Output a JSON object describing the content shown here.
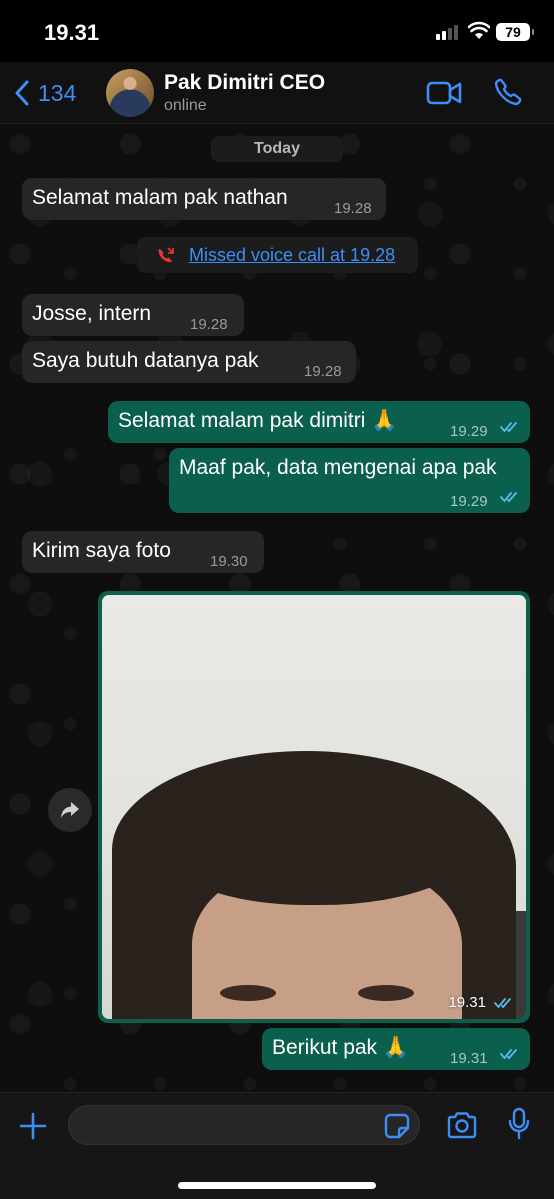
{
  "status_bar": {
    "time": "19.31",
    "battery": "79"
  },
  "header": {
    "back_count": "134",
    "contact_name": "Pak Dimitri CEO",
    "contact_status": "online"
  },
  "chat": {
    "date_label": "Today",
    "messages": [
      {
        "direction": "in",
        "text": "Selamat malam pak nathan",
        "time": "19.28"
      },
      {
        "direction": "system",
        "text": "Missed voice call at 19.28"
      },
      {
        "direction": "in",
        "text": "Josse, intern",
        "time": "19.28"
      },
      {
        "direction": "in",
        "text": "Saya butuh datanya pak",
        "time": "19.28"
      },
      {
        "direction": "out",
        "text": "Selamat malam pak dimitri 🙏",
        "time": "19.29",
        "read": true
      },
      {
        "direction": "out",
        "text": "Maaf pak, data mengenai apa pak",
        "time": "19.29",
        "read": true
      },
      {
        "direction": "in",
        "text": "Kirim saya foto",
        "time": "19.30"
      },
      {
        "direction": "out",
        "type": "photo",
        "time": "19.31",
        "read": true
      },
      {
        "direction": "out",
        "text": "Berikut pak 🙏",
        "time": "19.31",
        "read": true
      }
    ]
  },
  "input_bar": {
    "placeholder": ""
  },
  "icons": {
    "back": "chevron-left-icon",
    "video": "video-camera-icon",
    "call": "phone-icon",
    "missed_call": "missed-call-icon",
    "forward": "forward-arrow-icon",
    "plus": "plus-icon",
    "sticker": "sticker-icon",
    "camera": "camera-icon",
    "mic": "microphone-icon"
  },
  "colors": {
    "accent": "#3d8ef5",
    "outgoing_bubble": "#0b5f4d",
    "incoming_bubble": "#262626",
    "read_ticks": "#53bdeb",
    "missed_call": "#e53935"
  }
}
